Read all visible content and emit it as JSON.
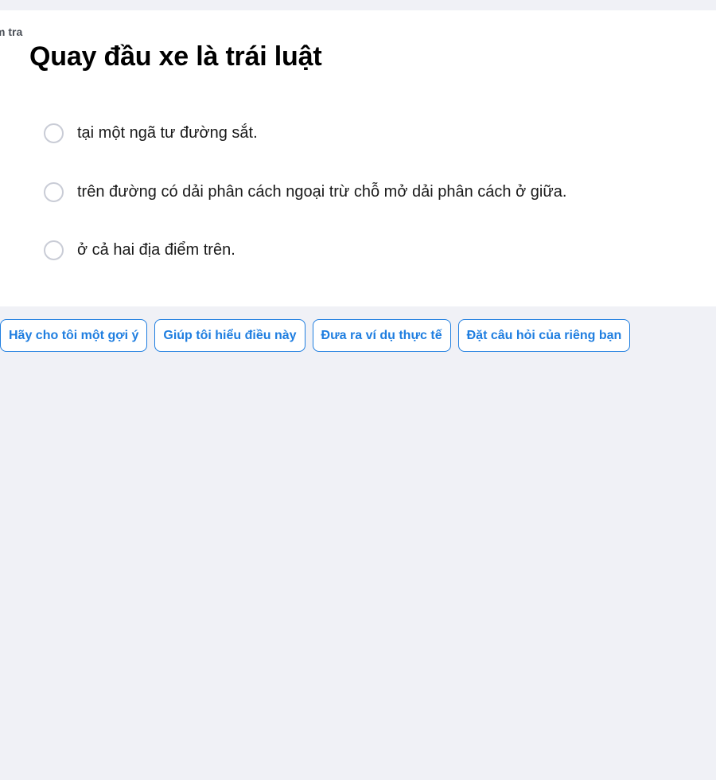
{
  "card": {
    "label": "m tra",
    "question": "Quay đầu xe là trái luật",
    "options": [
      {
        "text": "tại một ngã tư đường sắt.",
        "selected": false
      },
      {
        "text": "trên đường có dải phân cách ngoại trừ chỗ mở dải phân cách ở giữa.",
        "selected": false
      },
      {
        "text": "ở cả hai địa điểm trên.",
        "selected": false
      }
    ]
  },
  "suggestions": [
    "Hãy cho tôi một gợi ý",
    "Giúp tôi hiểu điều này",
    "Đưa ra ví dụ thực tế",
    "Đặt câu hỏi của riêng bạn"
  ],
  "colors": {
    "background": "#f0f1f6",
    "card": "#ffffff",
    "accent": "#1f7ee0",
    "radio_border": "#c9ccd6"
  }
}
